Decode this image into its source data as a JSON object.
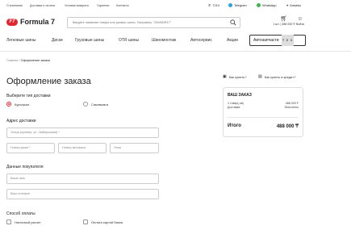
{
  "topbar": {
    "links": [
      "О компании",
      "Доставка и оплата",
      "Условия возврата",
      "Гарантии",
      "Контакты"
    ],
    "phone": "7210",
    "telegram": "Telegram",
    "whatsapp": "WhatsApp",
    "city": "Алматы"
  },
  "header": {
    "logo_mark": "F7",
    "logo_text": "Formula 7",
    "search_placeholder": "Введите название товара или размер шины. Например: \"265/65/R17\"",
    "cart_label": "1 шт. | 488 000 ₸",
    "login_label": "Войти"
  },
  "nav": {
    "items": [
      "Легковые шины",
      "Диски",
      "Грузовые шины",
      "OTR шины",
      "Шиномонтаж",
      "Автосервис",
      "Акции"
    ],
    "autoparts_label": "Автозапчасти",
    "autoparts_badges": [
      "Т",
      "К",
      "С"
    ]
  },
  "breadcrumb": {
    "home": "Главная",
    "sep": "/",
    "current": "Оформление заказа"
  },
  "page_title": "Оформление заказа",
  "help": {
    "how_buy": "Как купить?",
    "how_credit": "Как купить в кредит?"
  },
  "delivery": {
    "title": "Выберите тип доставки",
    "options": [
      "Курьером",
      "Самовывоз"
    ],
    "selected": "Курьером"
  },
  "address": {
    "title": "Адрес доставки",
    "street_placeholder": "Улица (пример: ул. Омбарсимов) *",
    "house_placeholder": "Номер дома *",
    "apt_placeholder": "Номер кв/офиса",
    "floor_placeholder": "Этаж"
  },
  "buyer": {
    "title": "Данные покупателя",
    "name_placeholder": "Ваше имя",
    "phone_placeholder": "Ваш телефон"
  },
  "payment": {
    "title": "Способ оплаты",
    "options": [
      "Наличный расчет",
      "Оплата картой банка"
    ]
  },
  "summary": {
    "title": "ВАШ ЗАКАЗ",
    "items_label": "1 товар(-ов)",
    "items_value": "488 000 ₸",
    "delivery_label": "Доставка",
    "delivery_value": "бесплатно",
    "total_label": "Итого",
    "total_value": "488 000 ₸"
  },
  "colors": {
    "brand": "#e3262e",
    "telegram": "#2aa3df",
    "whatsapp": "#3bb54a"
  }
}
